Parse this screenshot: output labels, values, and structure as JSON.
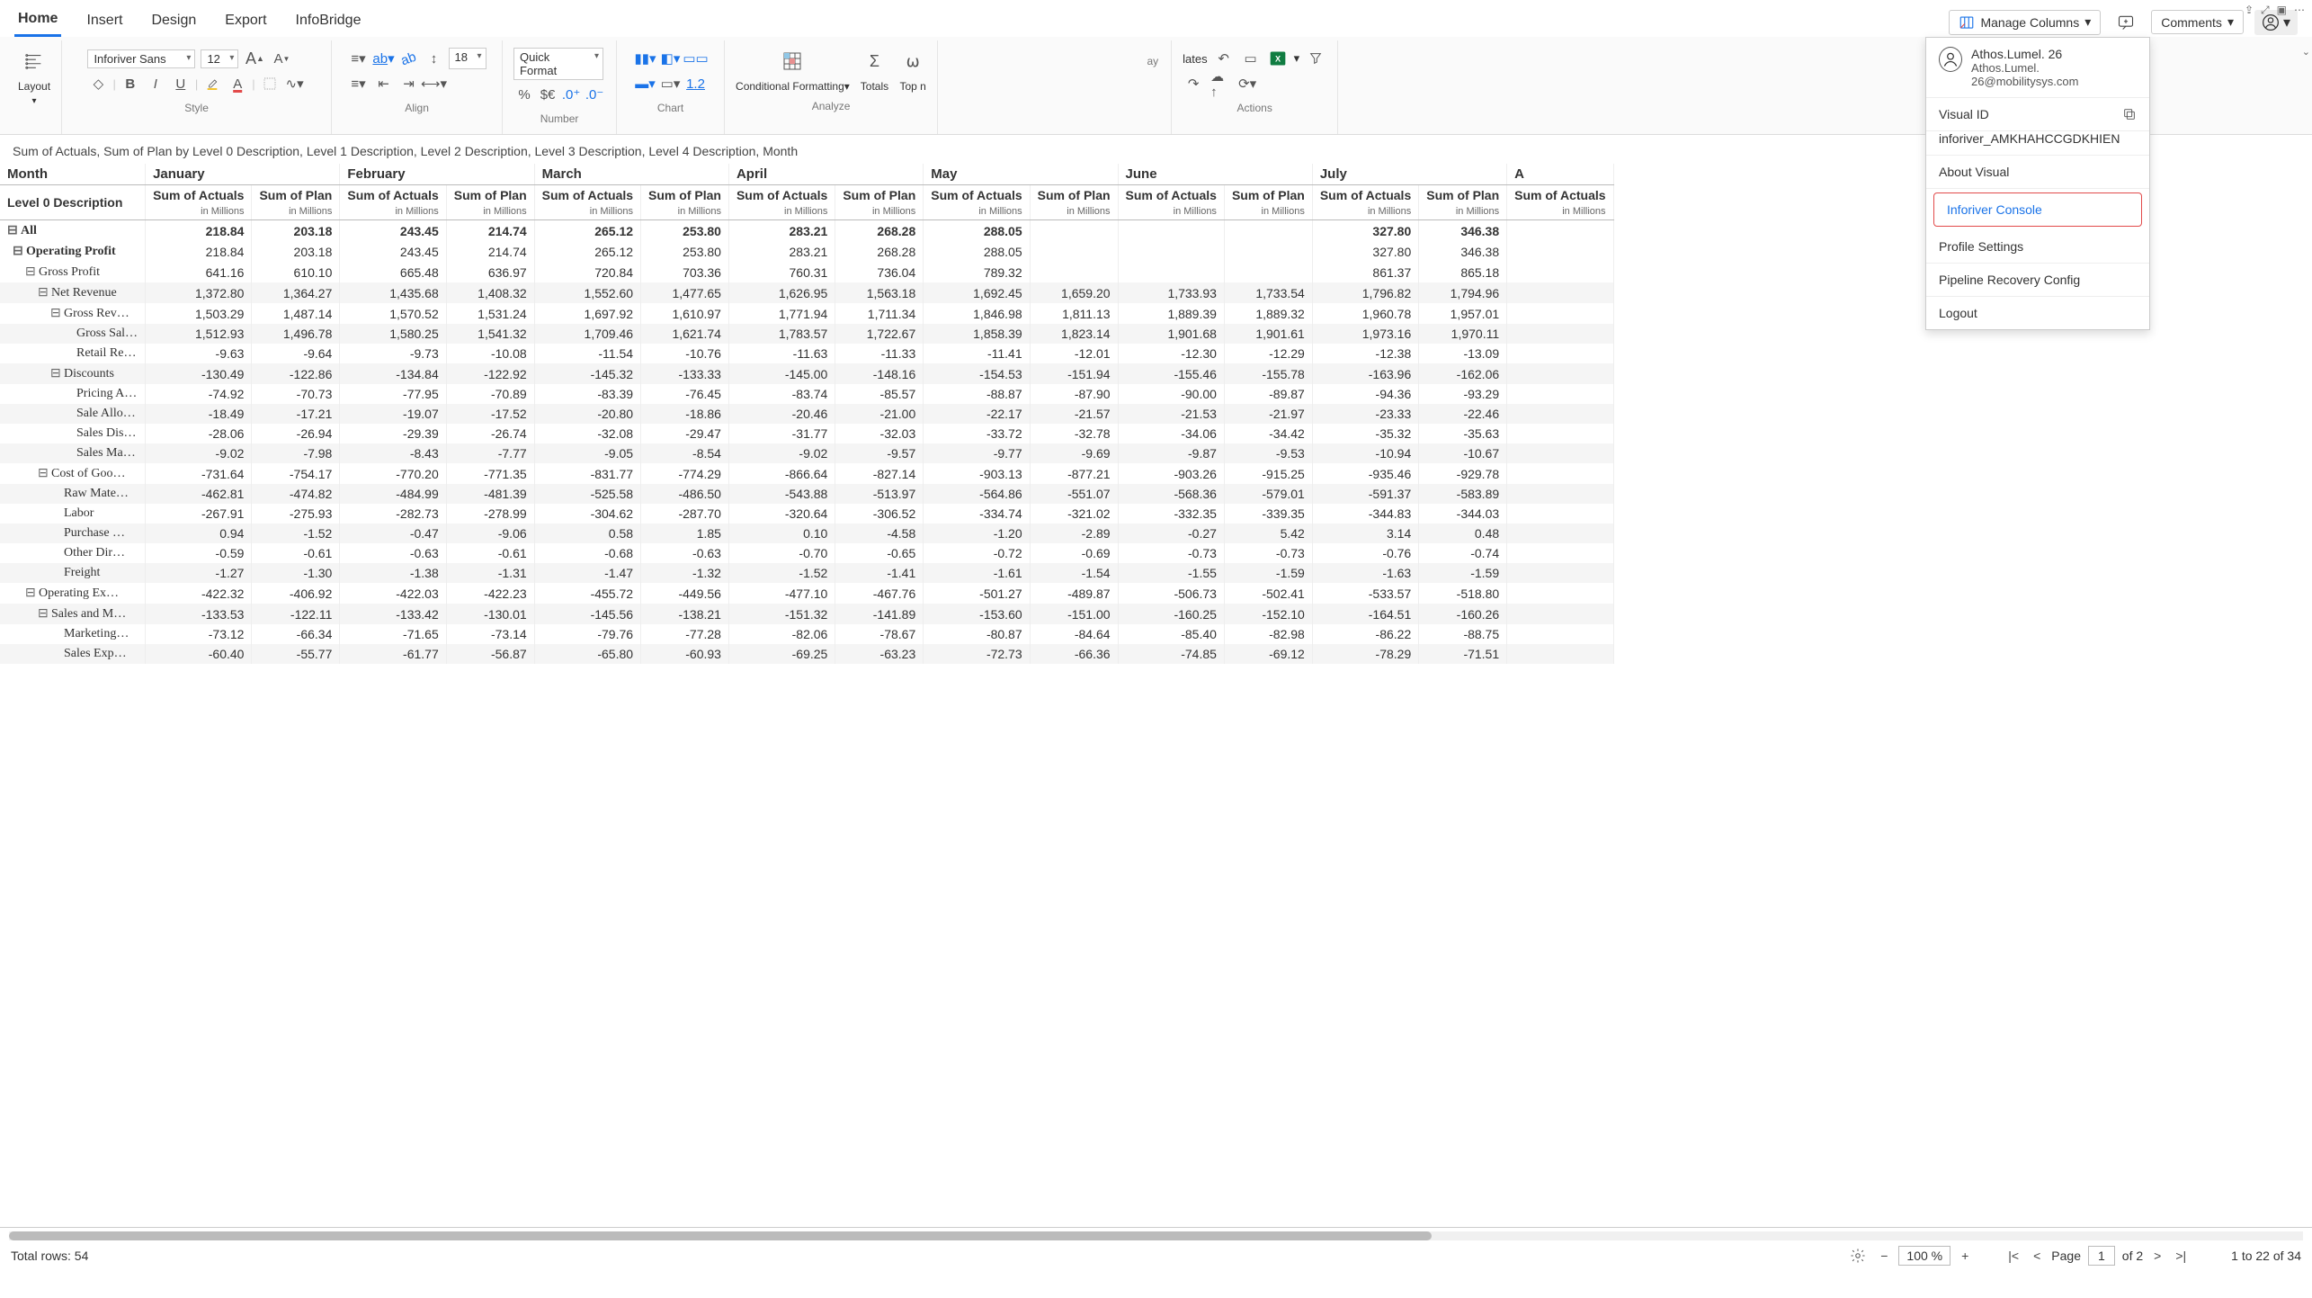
{
  "sys": {
    "pin": "⇪",
    "focus": "⤢",
    "pop": "▣",
    "more": "⋯"
  },
  "ribbon": {
    "tabs": [
      "Home",
      "Insert",
      "Design",
      "Export",
      "InfoBridge"
    ],
    "manage_columns": "Manage Columns",
    "comments": "Comments",
    "groups": {
      "layout": "Layout",
      "style": "Style",
      "align": "Align",
      "number": "Number",
      "chart": "Chart",
      "analyze": "Analyze",
      "actions": "Actions"
    },
    "font_name": "Inforiver Sans",
    "font_size": "12",
    "indent_size": "18",
    "quick_format": "Quick Format",
    "conditional_formatting": "Conditional Formatting",
    "totals": "Totals",
    "top": "Top n",
    "templates_partial": "lates",
    "display_partial": "ay"
  },
  "profile": {
    "name": "Athos.Lumel. 26",
    "email": "Athos.Lumel. 26@mobilitysys.com",
    "visual_id_label": "Visual ID",
    "visual_id": "inforiver_AMKHAHCCGDKHIEN",
    "about": "About Visual",
    "console": "Inforiver Console",
    "settings": "Profile Settings",
    "pipeline": "Pipeline Recovery Config",
    "logout": "Logout"
  },
  "subtitle": "Sum of Actuals, Sum of Plan by Level 0 Description, Level 1 Description, Level 2 Description, Level 3 Description, Level 4 Description, Month",
  "col_level0": "Level 0 Description",
  "col_month": "Month",
  "months": [
    "January",
    "February",
    "March",
    "April",
    "May",
    "June",
    "July",
    "A"
  ],
  "measure_a": "Sum of Actuals",
  "measure_b": "Sum of Plan",
  "unit": "in Millions",
  "rows": [
    {
      "label": "All",
      "depth": 0,
      "exp": "⊟",
      "vals": [
        "218.84",
        "203.18",
        "243.45",
        "214.74",
        "265.12",
        "253.80",
        "283.21",
        "268.28",
        "288.05",
        "",
        "",
        "",
        "327.80",
        "346.38"
      ]
    },
    {
      "label": "Operating Profit",
      "depth": 1,
      "exp": "⊟",
      "vals": [
        "218.84",
        "203.18",
        "243.45",
        "214.74",
        "265.12",
        "253.80",
        "283.21",
        "268.28",
        "288.05",
        "",
        "",
        "",
        "327.80",
        "346.38"
      ]
    },
    {
      "label": "Gross Profit",
      "depth": 2,
      "exp": "⊟",
      "vals": [
        "641.16",
        "610.10",
        "665.48",
        "636.97",
        "720.84",
        "703.36",
        "760.31",
        "736.04",
        "789.32",
        "",
        "",
        "",
        "861.37",
        "865.18"
      ]
    },
    {
      "label": "Net Revenue",
      "depth": 3,
      "exp": "⊟",
      "vals": [
        "1,372.80",
        "1,364.27",
        "1,435.68",
        "1,408.32",
        "1,552.60",
        "1,477.65",
        "1,626.95",
        "1,563.18",
        "1,692.45",
        "1,659.20",
        "1,733.93",
        "1,733.54",
        "1,796.82",
        "1,794.96"
      ]
    },
    {
      "label": "Gross Rev…",
      "depth": 4,
      "exp": "⊟",
      "vals": [
        "1,503.29",
        "1,487.14",
        "1,570.52",
        "1,531.24",
        "1,697.92",
        "1,610.97",
        "1,771.94",
        "1,711.34",
        "1,846.98",
        "1,811.13",
        "1,889.39",
        "1,889.32",
        "1,960.78",
        "1,957.01"
      ]
    },
    {
      "label": "Gross Sal…",
      "depth": 5,
      "exp": "",
      "vals": [
        "1,512.93",
        "1,496.78",
        "1,580.25",
        "1,541.32",
        "1,709.46",
        "1,621.74",
        "1,783.57",
        "1,722.67",
        "1,858.39",
        "1,823.14",
        "1,901.68",
        "1,901.61",
        "1,973.16",
        "1,970.11"
      ]
    },
    {
      "label": "Retail Re…",
      "depth": 5,
      "exp": "",
      "vals": [
        "-9.63",
        "-9.64",
        "-9.73",
        "-10.08",
        "-11.54",
        "-10.76",
        "-11.63",
        "-11.33",
        "-11.41",
        "-12.01",
        "-12.30",
        "-12.29",
        "-12.38",
        "-13.09"
      ]
    },
    {
      "label": "Discounts",
      "depth": 4,
      "exp": "⊟",
      "vals": [
        "-130.49",
        "-122.86",
        "-134.84",
        "-122.92",
        "-145.32",
        "-133.33",
        "-145.00",
        "-148.16",
        "-154.53",
        "-151.94",
        "-155.46",
        "-155.78",
        "-163.96",
        "-162.06"
      ]
    },
    {
      "label": "Pricing A…",
      "depth": 5,
      "exp": "",
      "vals": [
        "-74.92",
        "-70.73",
        "-77.95",
        "-70.89",
        "-83.39",
        "-76.45",
        "-83.74",
        "-85.57",
        "-88.87",
        "-87.90",
        "-90.00",
        "-89.87",
        "-94.36",
        "-93.29"
      ]
    },
    {
      "label": "Sale Allo…",
      "depth": 5,
      "exp": "",
      "vals": [
        "-18.49",
        "-17.21",
        "-19.07",
        "-17.52",
        "-20.80",
        "-18.86",
        "-20.46",
        "-21.00",
        "-22.17",
        "-21.57",
        "-21.53",
        "-21.97",
        "-23.33",
        "-22.46"
      ]
    },
    {
      "label": "Sales Dis…",
      "depth": 5,
      "exp": "",
      "vals": [
        "-28.06",
        "-26.94",
        "-29.39",
        "-26.74",
        "-32.08",
        "-29.47",
        "-31.77",
        "-32.03",
        "-33.72",
        "-32.78",
        "-34.06",
        "-34.42",
        "-35.32",
        "-35.63"
      ]
    },
    {
      "label": "Sales Ma…",
      "depth": 5,
      "exp": "",
      "vals": [
        "-9.02",
        "-7.98",
        "-8.43",
        "-7.77",
        "-9.05",
        "-8.54",
        "-9.02",
        "-9.57",
        "-9.77",
        "-9.69",
        "-9.87",
        "-9.53",
        "-10.94",
        "-10.67"
      ]
    },
    {
      "label": "Cost of Goo…",
      "depth": 3,
      "exp": "⊟",
      "vals": [
        "-731.64",
        "-754.17",
        "-770.20",
        "-771.35",
        "-831.77",
        "-774.29",
        "-866.64",
        "-827.14",
        "-903.13",
        "-877.21",
        "-903.26",
        "-915.25",
        "-935.46",
        "-929.78"
      ]
    },
    {
      "label": "Raw Mate…",
      "depth": 4,
      "exp": "",
      "vals": [
        "-462.81",
        "-474.82",
        "-484.99",
        "-481.39",
        "-525.58",
        "-486.50",
        "-543.88",
        "-513.97",
        "-564.86",
        "-551.07",
        "-568.36",
        "-579.01",
        "-591.37",
        "-583.89"
      ]
    },
    {
      "label": "Labor",
      "depth": 4,
      "exp": "",
      "vals": [
        "-267.91",
        "-275.93",
        "-282.73",
        "-278.99",
        "-304.62",
        "-287.70",
        "-320.64",
        "-306.52",
        "-334.74",
        "-321.02",
        "-332.35",
        "-339.35",
        "-344.83",
        "-344.03"
      ]
    },
    {
      "label": "Purchase …",
      "depth": 4,
      "exp": "",
      "vals": [
        "0.94",
        "-1.52",
        "-0.47",
        "-9.06",
        "0.58",
        "1.85",
        "0.10",
        "-4.58",
        "-1.20",
        "-2.89",
        "-0.27",
        "5.42",
        "3.14",
        "0.48"
      ]
    },
    {
      "label": "Other Dir…",
      "depth": 4,
      "exp": "",
      "vals": [
        "-0.59",
        "-0.61",
        "-0.63",
        "-0.61",
        "-0.68",
        "-0.63",
        "-0.70",
        "-0.65",
        "-0.72",
        "-0.69",
        "-0.73",
        "-0.73",
        "-0.76",
        "-0.74"
      ]
    },
    {
      "label": "Freight",
      "depth": 4,
      "exp": "",
      "vals": [
        "-1.27",
        "-1.30",
        "-1.38",
        "-1.31",
        "-1.47",
        "-1.32",
        "-1.52",
        "-1.41",
        "-1.61",
        "-1.54",
        "-1.55",
        "-1.59",
        "-1.63",
        "-1.59"
      ]
    },
    {
      "label": "Operating Ex…",
      "depth": 2,
      "exp": "⊟",
      "vals": [
        "-422.32",
        "-406.92",
        "-422.03",
        "-422.23",
        "-455.72",
        "-449.56",
        "-477.10",
        "-467.76",
        "-501.27",
        "-489.87",
        "-506.73",
        "-502.41",
        "-533.57",
        "-518.80"
      ]
    },
    {
      "label": "Sales and M…",
      "depth": 3,
      "exp": "⊟",
      "vals": [
        "-133.53",
        "-122.11",
        "-133.42",
        "-130.01",
        "-145.56",
        "-138.21",
        "-151.32",
        "-141.89",
        "-153.60",
        "-151.00",
        "-160.25",
        "-152.10",
        "-164.51",
        "-160.26"
      ]
    },
    {
      "label": "Marketing…",
      "depth": 4,
      "exp": "",
      "vals": [
        "-73.12",
        "-66.34",
        "-71.65",
        "-73.14",
        "-79.76",
        "-77.28",
        "-82.06",
        "-78.67",
        "-80.87",
        "-84.64",
        "-85.40",
        "-82.98",
        "-86.22",
        "-88.75"
      ]
    },
    {
      "label": "Sales Exp…",
      "depth": 4,
      "exp": "",
      "vals": [
        "-60.40",
        "-55.77",
        "-61.77",
        "-56.87",
        "-65.80",
        "-60.93",
        "-69.25",
        "-63.23",
        "-72.73",
        "-66.36",
        "-74.85",
        "-69.12",
        "-78.29",
        "-71.51"
      ]
    }
  ],
  "footer": {
    "total_rows": "Total rows: 54",
    "zoom": "100 %",
    "page_label": "Page",
    "page_num": "1",
    "page_of": "of 2",
    "range": "1  to  22  of 34"
  }
}
